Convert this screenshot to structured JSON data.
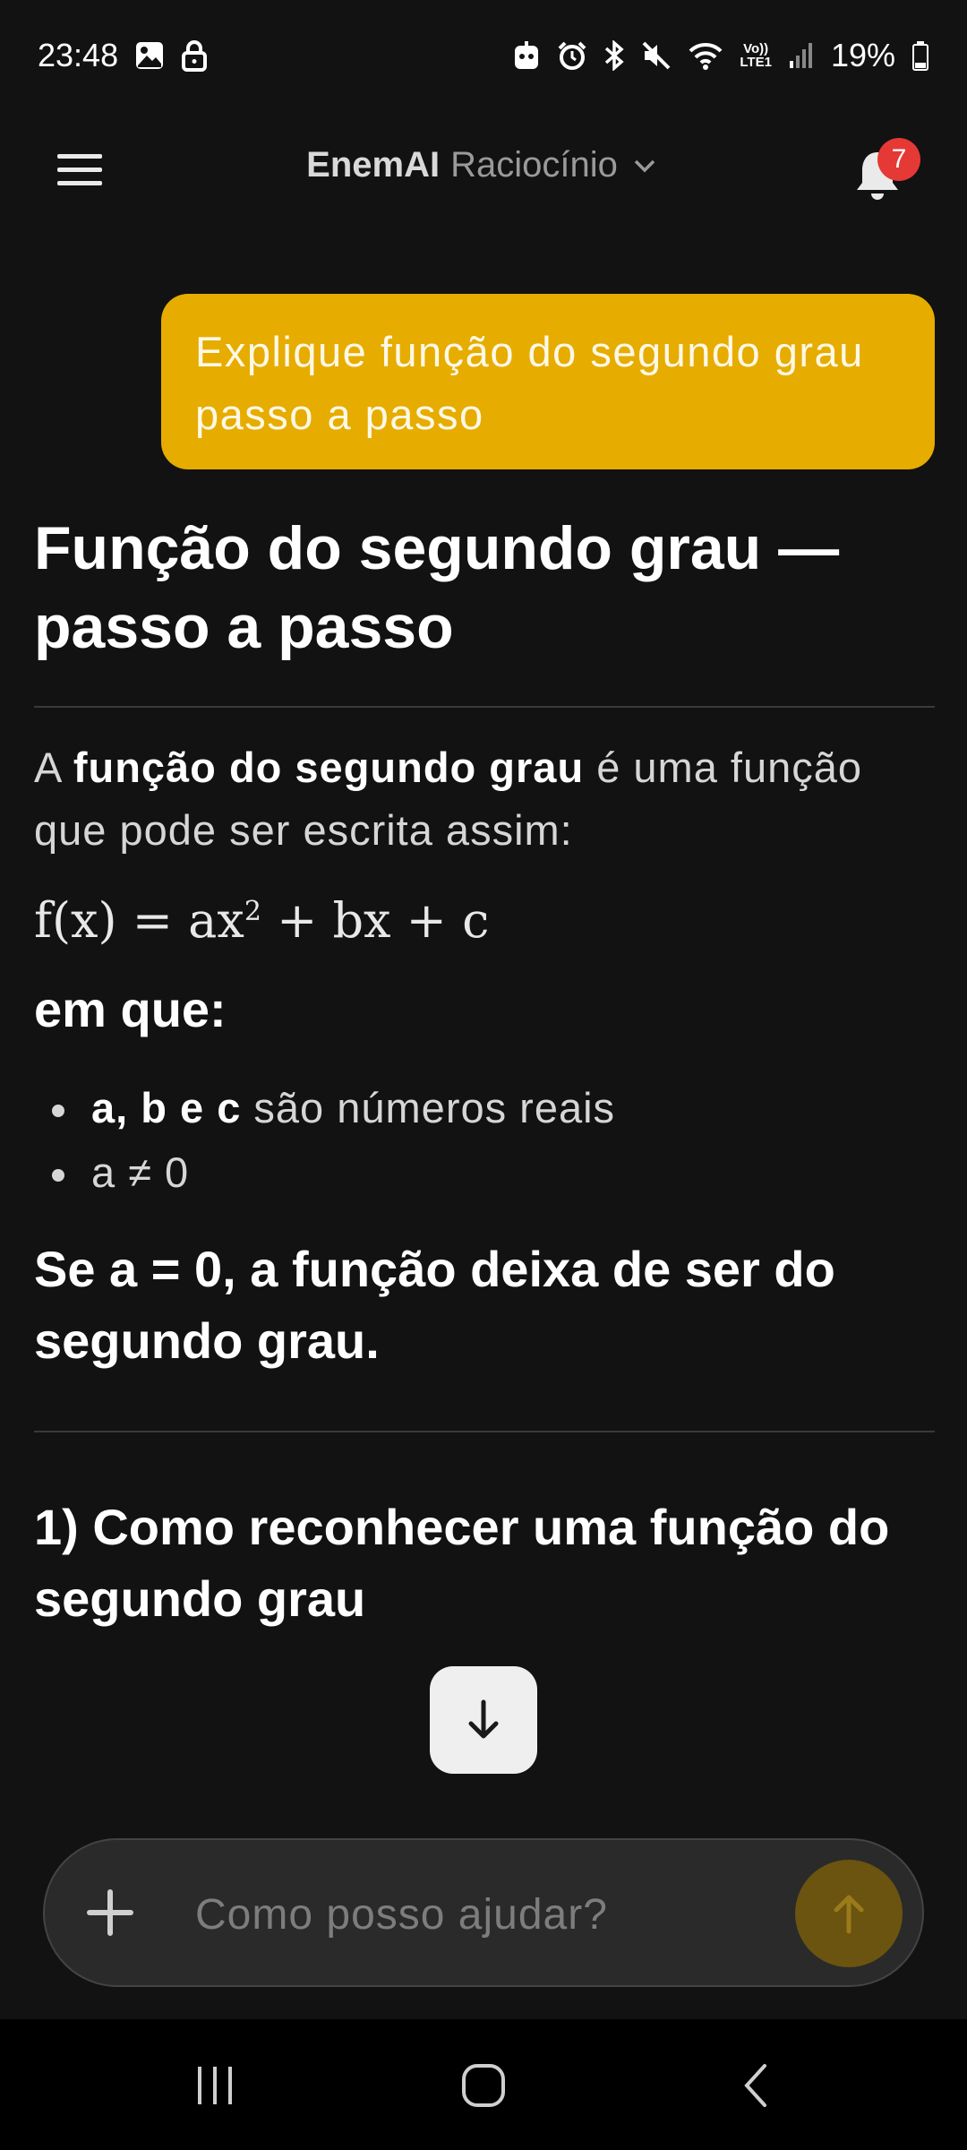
{
  "status_bar": {
    "time": "23:48",
    "lte_top": "Vo))",
    "lte_bottom": "LTE1",
    "battery_percent": "19%"
  },
  "header": {
    "brand": "EnemAI",
    "model": "Raciocínio",
    "notification_count": "7"
  },
  "chat": {
    "user_message": "Explique função do segundo grau passo a passo"
  },
  "answer": {
    "title": "Função do segundo grau — passo a passo",
    "intro_prefix": "A ",
    "intro_bold": "função do segundo grau",
    "intro_suffix": " é uma função que pode ser escrita assim:",
    "formula_lhs": "f(x) = ax",
    "formula_exp": "2",
    "formula_rhs": " + bx + c",
    "where_heading": "em que:",
    "bullets": [
      {
        "bold": "a, b e c",
        "text": " são números reais"
      },
      {
        "bold": "",
        "text": "a ≠ 0"
      }
    ],
    "note": "Se a = 0, a função deixa de ser do segundo grau.",
    "section_1_title": "1) Como reconhecer uma função do segundo grau"
  },
  "composer": {
    "placeholder": "Como posso ajudar?"
  },
  "colors": {
    "background": "#121212",
    "accent": "#e6ac00",
    "badge": "#e53935"
  }
}
